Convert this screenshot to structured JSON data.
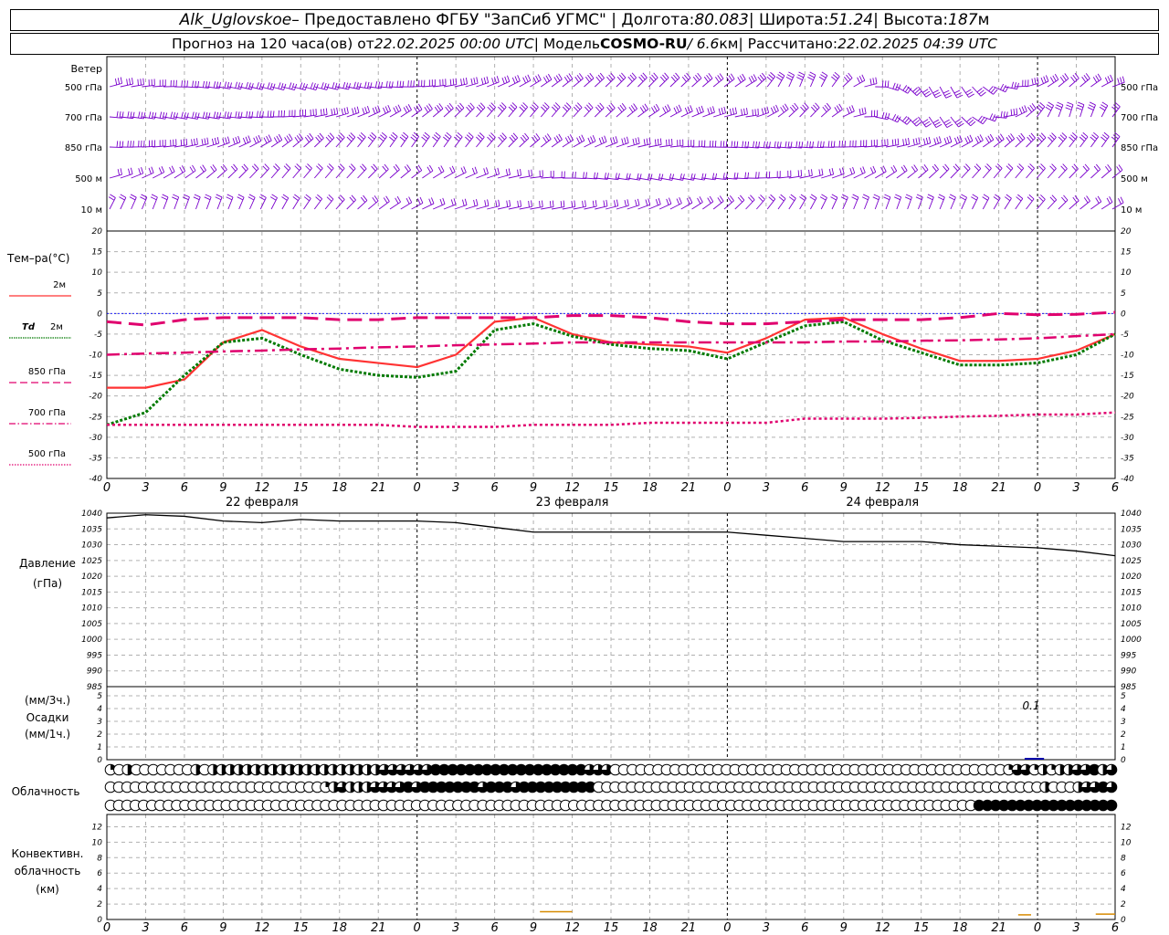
{
  "header": {
    "station": "Alk_Uglovskoe",
    "provider": " – Предоставлено ФГБУ \"ЗапСиб УГМС\" | Долгота: ",
    "lon": "80.083",
    "lat_label": " | Широта: ",
    "lat": "51.24",
    "alt_label": " | Высота: ",
    "alt": "187",
    "alt_unit": "м",
    "fc_label": "Прогноз на 120 часа(ов) от ",
    "fc_time": "22.02.2025 00:00 UTC",
    "model_label": " | Модель ",
    "model": "COSMO-RU",
    "res": " / 6.6",
    "res_unit": "км",
    "calc_label": " | Рассчитано: ",
    "calc_time": "22.02.2025 04:39 UTC"
  },
  "colors": {
    "t2m": "#ff3333",
    "td2m": "#007a00",
    "t850": "#e0006e",
    "wind": "#7a00cc",
    "pressure": "#000000",
    "zero_line": "#0000ff",
    "convective": "#d68a00"
  },
  "chart_data": [
    {
      "type": "line",
      "panel": "wind",
      "title": "Ветер",
      "levels": [
        "500 гПа",
        "700 гПа",
        "850 гПа",
        "500 м",
        "10 м"
      ]
    },
    {
      "type": "line",
      "panel": "temperature",
      "ylabel": "Тем–ра(°C)",
      "ylim": [
        -40,
        20
      ],
      "yticks": [
        20,
        15,
        10,
        5,
        0,
        -5,
        -10,
        -15,
        -20,
        -25,
        -30,
        -35,
        -40
      ],
      "x_hours": [
        0,
        3,
        6,
        9,
        12,
        15,
        18,
        21,
        24,
        27,
        30,
        33,
        36,
        39,
        42,
        45,
        48,
        51,
        54,
        57,
        60,
        63,
        66,
        69,
        72,
        75,
        78
      ],
      "x_tick_labels": [
        "0",
        "3",
        "6",
        "9",
        "12",
        "15",
        "18",
        "21",
        "0",
        "3",
        "6",
        "9",
        "12",
        "15",
        "18",
        "21",
        "0",
        "3",
        "6",
        "9",
        "12",
        "15",
        "18",
        "21",
        "0",
        "3",
        "6"
      ],
      "date_labels": [
        "22 февраля",
        "23 февраля",
        "24 февраля"
      ],
      "series": [
        {
          "name": "2м",
          "label_prefix": "",
          "style": "solid",
          "values": [
            -18,
            -18,
            -16,
            -7,
            -4,
            -8,
            -11,
            -12,
            -13,
            -10,
            -2,
            -1,
            -5,
            -7,
            -7.5,
            -8,
            -9.5,
            -6,
            -1.5,
            -1,
            -5,
            -8.5,
            -11.5,
            -11.5,
            -11,
            -9,
            -5
          ]
        },
        {
          "name": "2м",
          "label_prefix": "Td",
          "style": "dotted-thick",
          "values": [
            -27,
            -24,
            -15,
            -7,
            -6,
            -10,
            -13.5,
            -15,
            -15.5,
            -14,
            -4,
            -2.5,
            -5.5,
            -7.5,
            -8.5,
            -9,
            -11,
            -7,
            -3,
            -2,
            -6.5,
            -9.5,
            -12.5,
            -12.5,
            -12,
            -10,
            -5
          ]
        },
        {
          "name": "850 гПа",
          "label_prefix": "",
          "style": "long-dash",
          "values": [
            -2,
            -2.8,
            -1.5,
            -1,
            -1,
            -1,
            -1.5,
            -1.5,
            -1,
            -1,
            -1,
            -1,
            -0.5,
            -0.5,
            -1,
            -2,
            -2.5,
            -2.5,
            -2,
            -1.5,
            -1.5,
            -1.5,
            -1,
            0,
            -0.3,
            -0.2,
            0.3
          ]
        },
        {
          "name": "700 гПа",
          "label_prefix": "",
          "style": "dash-dot",
          "values": [
            -10,
            -9.7,
            -9.5,
            -9.2,
            -9,
            -8.7,
            -8.5,
            -8.2,
            -8,
            -7.7,
            -7.5,
            -7.3,
            -7,
            -7,
            -7,
            -7,
            -7,
            -7,
            -7,
            -6.8,
            -6.8,
            -6.6,
            -6.5,
            -6.3,
            -6.0,
            -5.5,
            -5
          ]
        },
        {
          "name": "500 гПа",
          "label_prefix": "",
          "style": "dotted",
          "values": [
            -27,
            -27,
            -27,
            -27,
            -27,
            -27,
            -27,
            -27,
            -27.5,
            -27.5,
            -27.5,
            -27,
            -27,
            -27,
            -26.5,
            -26.5,
            -26.5,
            -26.5,
            -25.5,
            -25.5,
            -25.5,
            -25.3,
            -25,
            -24.8,
            -24.5,
            -24.5,
            -24
          ]
        }
      ]
    },
    {
      "type": "line",
      "panel": "pressure",
      "ylabel": "Давление",
      "unit": "(гПа)",
      "ylim": [
        985,
        1040
      ],
      "yticks": [
        1040,
        1035,
        1030,
        1025,
        1020,
        1015,
        1010,
        1005,
        1000,
        995,
        990,
        985
      ],
      "values": [
        1038.5,
        1039.5,
        1039,
        1037.5,
        1037,
        1038,
        1037.5,
        1037.5,
        1037.5,
        1037,
        1035.5,
        1034,
        1034,
        1034,
        1034,
        1034,
        1034,
        1033,
        1032,
        1031,
        1031,
        1031,
        1030,
        1029.5,
        1029,
        1028,
        1026.5
      ]
    },
    {
      "type": "bar",
      "panel": "precipitation",
      "ylabel_top": "(мм/3ч.)",
      "ylabel": "Осадки",
      "ylabel_bottom": "(мм/1ч.)",
      "ylim": [
        0,
        5
      ],
      "yticks": [
        5,
        4,
        3,
        2,
        1,
        0
      ],
      "annotation": "0.1"
    },
    {
      "type": "table",
      "panel": "cloudiness",
      "ylabel": "Облачность",
      "rows": [
        [
          1,
          0,
          2,
          0,
          0,
          0,
          0,
          0,
          0,
          0,
          2,
          0,
          2,
          2,
          2,
          2,
          2,
          2,
          2,
          2,
          2,
          2,
          2,
          2,
          2,
          2,
          2,
          2,
          2,
          2,
          2,
          2,
          3,
          3,
          3,
          3,
          3,
          3,
          4,
          4,
          4,
          4,
          4,
          4,
          4,
          4,
          4,
          4,
          4,
          4,
          4,
          4,
          4,
          4,
          4,
          4,
          3,
          3,
          3,
          0,
          0,
          0,
          0,
          0,
          0,
          0,
          0,
          0,
          0,
          0,
          0,
          0,
          0,
          0,
          0,
          0,
          0,
          0,
          0,
          0,
          0,
          0,
          0,
          0,
          0,
          0,
          0,
          0,
          0,
          0,
          0,
          0,
          0,
          0,
          0,
          0,
          0,
          0,
          0,
          0,
          0,
          0,
          0,
          0,
          0,
          1,
          3,
          3,
          1,
          2,
          1,
          2,
          2,
          3,
          3,
          4,
          2,
          3
        ],
        [
          0,
          0,
          0,
          0,
          0,
          0,
          0,
          0,
          0,
          0,
          0,
          0,
          0,
          0,
          0,
          0,
          0,
          0,
          0,
          0,
          0,
          0,
          0,
          0,
          0,
          0,
          1,
          2,
          3,
          2,
          2,
          2,
          3,
          3,
          3,
          3,
          4,
          3,
          4,
          4,
          4,
          4,
          4,
          4,
          4,
          3,
          4,
          4,
          4,
          3,
          4,
          4,
          4,
          4,
          4,
          4,
          4,
          4,
          4,
          0,
          0,
          0,
          0,
          0,
          0,
          0,
          0,
          0,
          0,
          0,
          0,
          0,
          0,
          0,
          0,
          0,
          0,
          0,
          0,
          0,
          0,
          0,
          0,
          0,
          0,
          0,
          0,
          0,
          0,
          0,
          0,
          0,
          0,
          0,
          0,
          0,
          0,
          0,
          0,
          0,
          0,
          0,
          0,
          0,
          0,
          0,
          0,
          0,
          0,
          0,
          0,
          0,
          0,
          2,
          0,
          0,
          0,
          2,
          3,
          3,
          4,
          3
        ],
        [
          0,
          0,
          0,
          0,
          0,
          0,
          0,
          0,
          0,
          0,
          0,
          0,
          0,
          0,
          0,
          0,
          0,
          0,
          0,
          0,
          0,
          0,
          0,
          0,
          0,
          0,
          0,
          0,
          0,
          0,
          0,
          0,
          0,
          0,
          0,
          0,
          0,
          0,
          0,
          0,
          0,
          0,
          0,
          0,
          0,
          0,
          0,
          0,
          0,
          0,
          0,
          0,
          0,
          0,
          0,
          0,
          0,
          0,
          0,
          0,
          0,
          0,
          0,
          0,
          0,
          0,
          0,
          0,
          0,
          0,
          0,
          0,
          0,
          0,
          0,
          0,
          0,
          0,
          0,
          0,
          0,
          0,
          0,
          0,
          0,
          0,
          0,
          0,
          0,
          0,
          0,
          0,
          0,
          0,
          0,
          0,
          0,
          0,
          0,
          0,
          0,
          0,
          0,
          0,
          0,
          4,
          4,
          4,
          4,
          4,
          4,
          4,
          4,
          4,
          4,
          4,
          4,
          4,
          4,
          4,
          4,
          4
        ]
      ]
    },
    {
      "type": "line",
      "panel": "convective",
      "ylabel": "Конвективн.",
      "ylabel2": "облачность",
      "unit": "(км)",
      "ylim": [
        0,
        13
      ],
      "yticks": [
        12,
        10,
        8,
        6,
        4,
        2,
        0
      ],
      "x_tick_labels": [
        "0",
        "3",
        "6",
        "9",
        "12",
        "15",
        "18",
        "21",
        "0",
        "3",
        "6",
        "9",
        "12",
        "15",
        "18",
        "21",
        "0",
        "3",
        "6",
        "9",
        "12",
        "15",
        "18",
        "21",
        "0",
        "3",
        "6"
      ]
    }
  ]
}
